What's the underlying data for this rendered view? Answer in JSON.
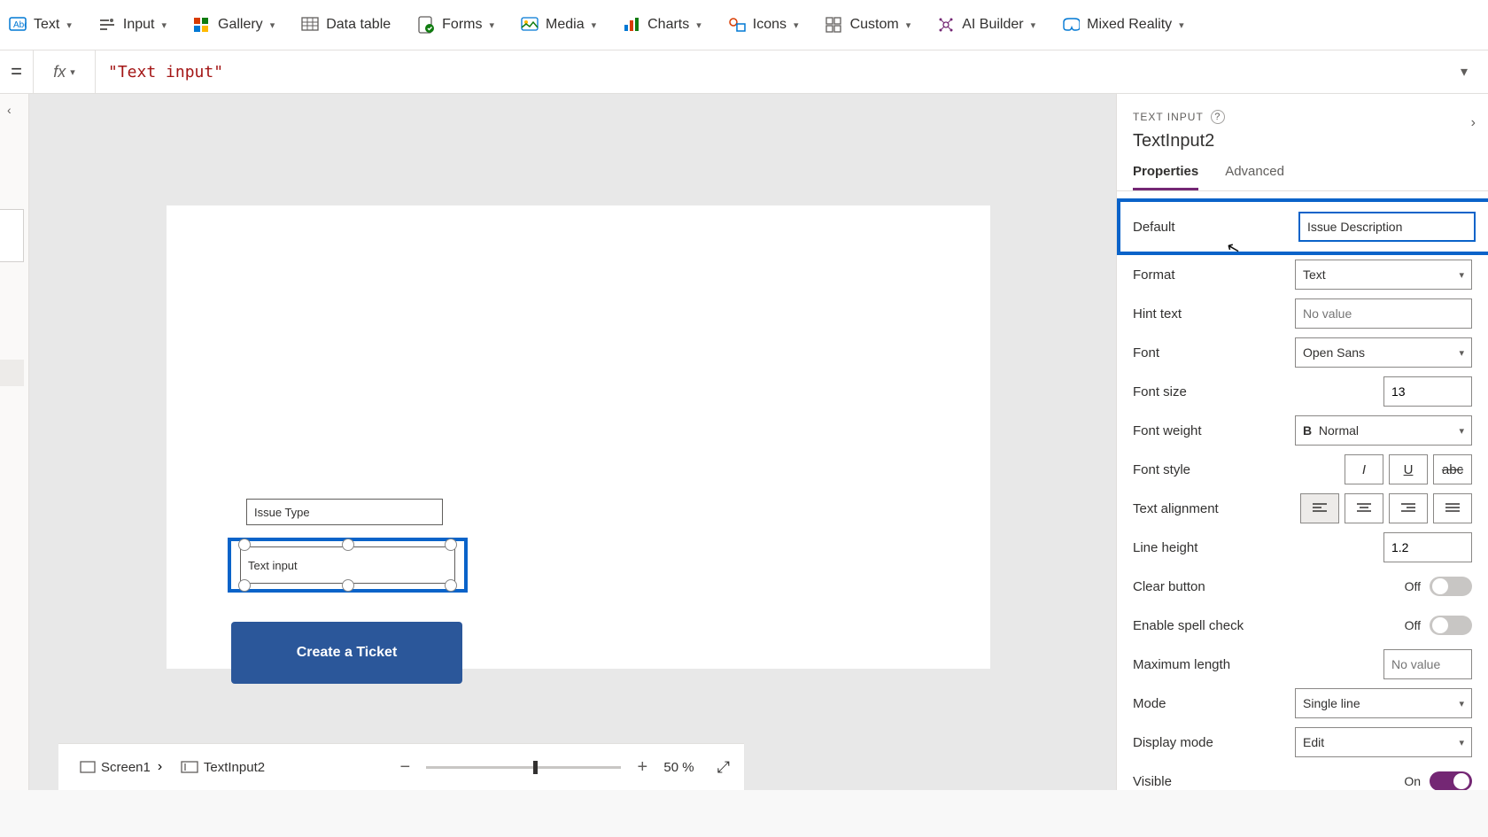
{
  "ribbon": {
    "items": [
      {
        "label": "Text"
      },
      {
        "label": "Input"
      },
      {
        "label": "Gallery"
      },
      {
        "label": "Data table"
      },
      {
        "label": "Forms"
      },
      {
        "label": "Media"
      },
      {
        "label": "Charts"
      },
      {
        "label": "Icons"
      },
      {
        "label": "Custom"
      },
      {
        "label": "AI Builder"
      },
      {
        "label": "Mixed Reality"
      }
    ]
  },
  "formula_bar": {
    "eq": "=",
    "fx": "fx",
    "value": "\"Text input\""
  },
  "canvas": {
    "field1_value": "Issue Type",
    "selected_text": "Text input",
    "button_label": "Create a Ticket"
  },
  "right_pane": {
    "type_label": "TEXT INPUT",
    "control_name": "TextInput2",
    "tabs": {
      "properties": "Properties",
      "advanced": "Advanced"
    },
    "props": {
      "default_label": "Default",
      "default_value": "Issue Description",
      "format_label": "Format",
      "format_value": "Text",
      "hint_label": "Hint text",
      "hint_placeholder": "No value",
      "font_label": "Font",
      "font_value": "Open Sans",
      "fontsize_label": "Font size",
      "fontsize_value": "13",
      "fontweight_label": "Font weight",
      "fontweight_value": "Normal",
      "fontstyle_label": "Font style",
      "textalign_label": "Text alignment",
      "lineheight_label": "Line height",
      "lineheight_value": "1.2",
      "clearbtn_label": "Clear button",
      "clearbtn_state": "Off",
      "spell_label": "Enable spell check",
      "spell_state": "Off",
      "maxlen_label": "Maximum length",
      "maxlen_placeholder": "No value",
      "mode_label": "Mode",
      "mode_value": "Single line",
      "displaymode_label": "Display mode",
      "displaymode_value": "Edit",
      "visible_label": "Visible",
      "visible_state": "On"
    }
  },
  "breadcrumb": {
    "screen": "Screen1",
    "control": "TextInput2"
  },
  "zoom": {
    "pct": "50",
    "unit": "%"
  }
}
